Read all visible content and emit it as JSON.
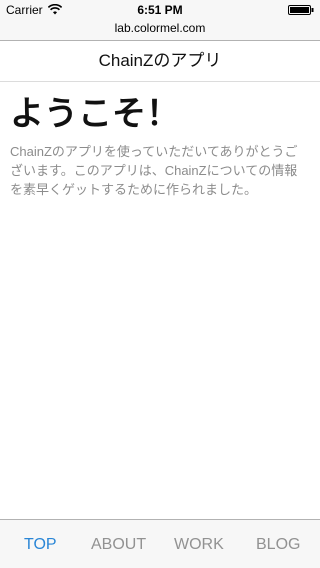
{
  "status_bar": {
    "carrier": "Carrier",
    "time": "6:51 PM",
    "wifi_icon": "wifi-icon",
    "battery_icon": "battery-icon"
  },
  "browser": {
    "url": "lab.colormel.com"
  },
  "header": {
    "title": "ChainZのアプリ"
  },
  "main": {
    "heading": "ようこそ！",
    "intro": "ChainZのアプリを使っていただいてありがとうございます。このアプリは、ChainZについての情報を素早くゲットするために作られました。"
  },
  "tabs": [
    {
      "label": "TOP",
      "active": true
    },
    {
      "label": "ABOUT",
      "active": false
    },
    {
      "label": "WORK",
      "active": false
    },
    {
      "label": "BLOG",
      "active": false
    }
  ],
  "colors": {
    "active_tab": "#2a86d6",
    "inactive_tab": "#929292",
    "body_text": "#8c8c8c",
    "bar_background": "#f7f7f7"
  }
}
